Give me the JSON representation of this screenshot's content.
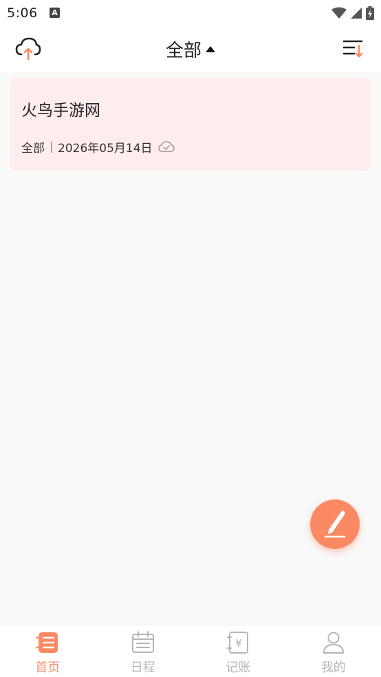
{
  "status_bar": {
    "time": "5:06",
    "notification_icon": "A"
  },
  "header": {
    "title": "全部",
    "left_icon": "cloud-upload-icon",
    "right_icon": "sort-icon"
  },
  "notes": [
    {
      "title": "火鸟手游网",
      "category": "全部",
      "date": "2026年05月14日",
      "sync_icon": "cloud-check-icon"
    }
  ],
  "colors": {
    "accent": "#fb8a64",
    "card_bg": "#ffecec",
    "inactive": "#b5b5b5"
  },
  "bottom_nav": [
    {
      "label": "首页",
      "icon": "notes-icon",
      "active": true
    },
    {
      "label": "日程",
      "icon": "calendar-icon",
      "active": false
    },
    {
      "label": "记账",
      "icon": "ledger-icon",
      "active": false
    },
    {
      "label": "我的",
      "icon": "profile-icon",
      "active": false
    }
  ]
}
